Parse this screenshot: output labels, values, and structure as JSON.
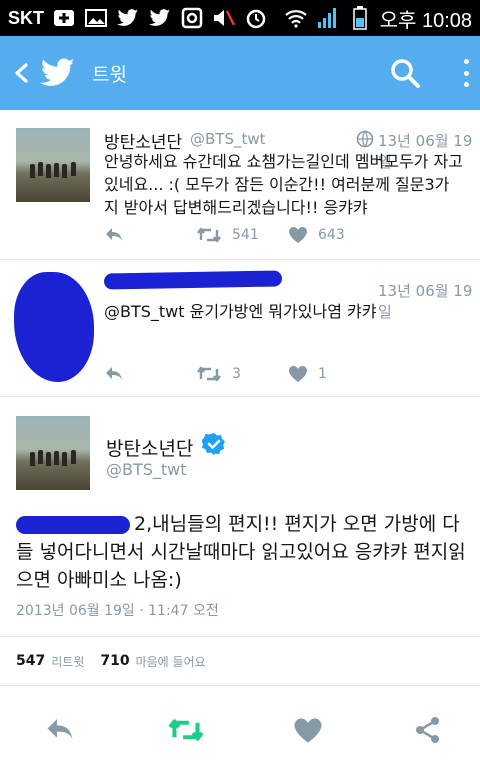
{
  "status_bar": {
    "carrier": "SKT",
    "time": "오후 10:08",
    "icons": [
      "add-box-icon",
      "image-icon",
      "twitter-bird-icon",
      "twitter-bird-icon",
      "instagram-icon",
      "mute-icon",
      "alarm-icon",
      "wifi-icon",
      "signal-icon",
      "battery-icon"
    ]
  },
  "header": {
    "title": "트윗",
    "back_icon": "back-arrow-icon",
    "logo_icon": "twitter-bird-icon",
    "search_icon": "search-icon",
    "more_icon": "more-vertical-icon",
    "color": "#55acee"
  },
  "tweets": [
    {
      "name": "방탄소년단",
      "handle": "@BTS_twt",
      "date": "13년 06월 19일",
      "text": "안녕하세요 슈간데요 쇼챔가는길인데 멤버모두가 자고있네요... :( 모두가 잠든 이순간!! 여러분께 질문3가지 받아서 답변해드리겠습니다!! 응캬캬",
      "retweets": "541",
      "likes": "643"
    },
    {
      "date": "13년 06월 19일",
      "text": "@BTS_twt 윤기가방엔 뭐가있나염 캬캬",
      "retweets": "3",
      "likes": "1"
    }
  ],
  "detail": {
    "name": "방탄소년단",
    "handle": "@BTS_twt",
    "verified": true,
    "text": "2,내님들의 편지!! 편지가 오면 가방에 다들 넣어다니면서 시간날때마다 읽고있어요 응캬캬 편지읽으면 아빠미소 나옴:)",
    "timestamp": "2013년 06월 19일 · 11:47 오전",
    "retweet_count": "547",
    "retweet_label": "리트윗",
    "like_count": "710",
    "like_label": "마음에 들어요"
  },
  "colors": {
    "accent": "#55acee",
    "retweet_active": "#19cf86",
    "muted": "#8899a6",
    "redaction": "#1a22d4"
  }
}
